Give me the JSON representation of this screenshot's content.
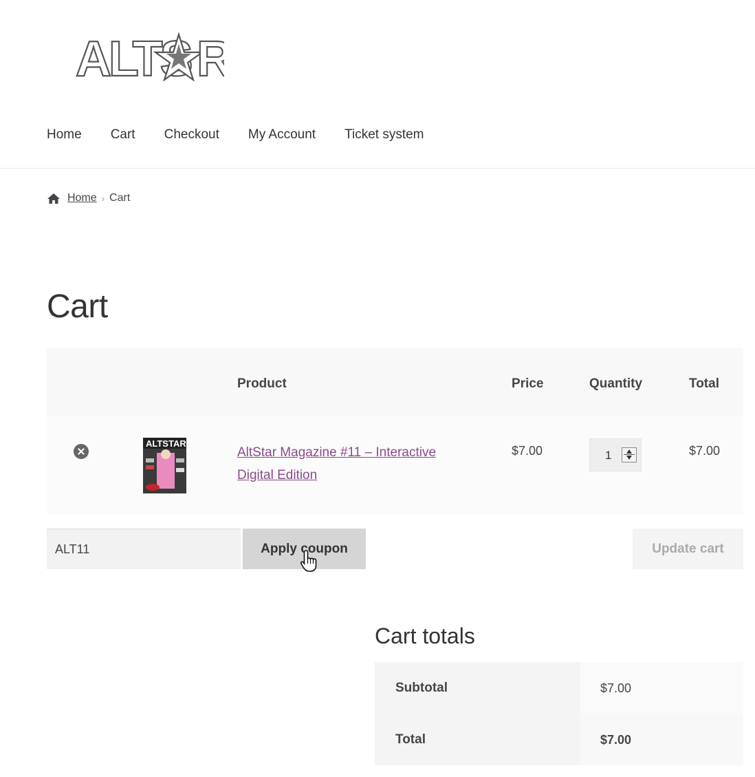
{
  "site": {
    "logo_text": "ALTSTAR"
  },
  "nav": [
    "Home",
    "Cart",
    "Checkout",
    "My Account",
    "Ticket system"
  ],
  "breadcrumb": {
    "home": "Home",
    "separator": "›",
    "current": "Cart"
  },
  "page_title": "Cart",
  "cart_table": {
    "headers": {
      "product": "Product",
      "price": "Price",
      "quantity": "Quantity",
      "total": "Total"
    },
    "items": [
      {
        "product_name": "AltStar Magazine #11 – Interactive Digital Edition",
        "thumbnail_text": "ALTSTAR",
        "price": "$7.00",
        "quantity": "1",
        "total": "$7.00"
      }
    ]
  },
  "coupon": {
    "value": "ALT11",
    "apply_label": "Apply coupon"
  },
  "update_cart_label": "Update cart",
  "cart_totals": {
    "title": "Cart totals",
    "subtotal_label": "Subtotal",
    "subtotal_value": "$7.00",
    "total_label": "Total",
    "total_value": "$7.00"
  },
  "colors": {
    "link": "#8b4a8b",
    "text": "#43454b"
  }
}
